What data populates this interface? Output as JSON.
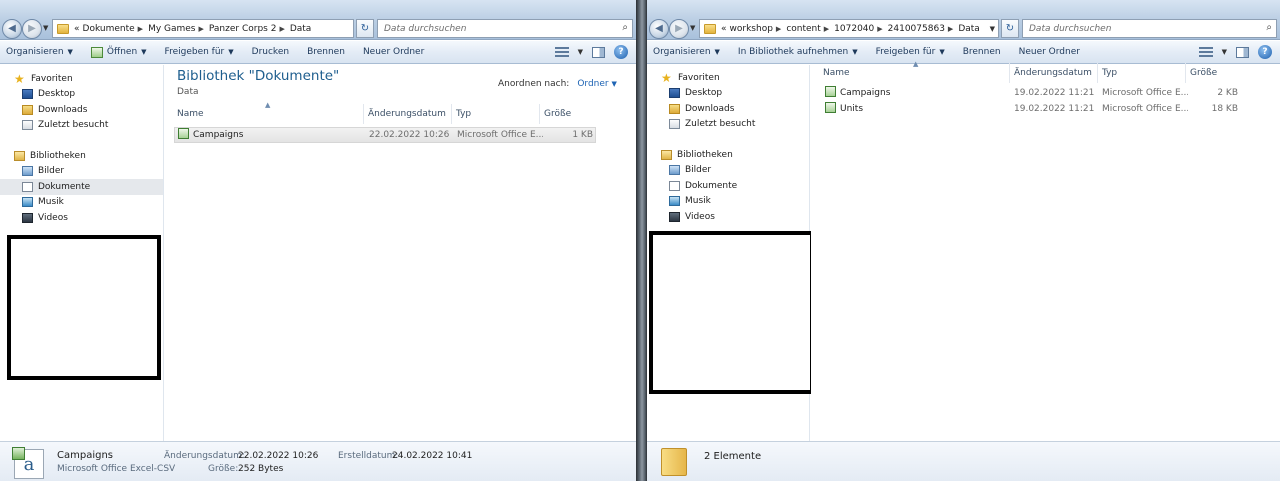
{
  "left": {
    "breadcrumb": [
      "«",
      "Dokumente",
      "My Games",
      "Panzer Corps 2",
      "Data"
    ],
    "search_placeholder": "Data durchsuchen",
    "toolbar": [
      "Organisieren",
      "Öffnen",
      "Freigeben für",
      "Drucken",
      "Brennen",
      "Neuer Ordner"
    ],
    "nav": {
      "favorites": "Favoriten",
      "fav_items": [
        "Desktop",
        "Downloads",
        "Zuletzt besucht"
      ],
      "libraries": "Bibliotheken",
      "lib_items": [
        "Bilder",
        "Dokumente",
        "Musik",
        "Videos"
      ]
    },
    "library_title": "Bibliothek \"Dokumente\"",
    "library_subtitle": "Data",
    "arrange_label": "Anordnen nach:",
    "arrange_value": "Ordner",
    "columns": [
      "Name",
      "Änderungsdatum",
      "Typ",
      "Größe"
    ],
    "files": [
      {
        "name": "Campaigns",
        "date": "22.02.2022 10:26",
        "type": "Microsoft Office E...",
        "size": "1 KB"
      }
    ],
    "status": {
      "name": "Campaigns",
      "type": "Microsoft Office Excel-CSV",
      "modified_label": "Änderungsdatum:",
      "modified": "22.02.2022 10:26",
      "created_label": "Erstelldatum:",
      "created": "24.02.2022 10:41",
      "size_label": "Größe:",
      "size": "252 Bytes"
    }
  },
  "right": {
    "breadcrumb": [
      "«",
      "workshop",
      "content",
      "1072040",
      "2410075863",
      "Data"
    ],
    "search_placeholder": "Data durchsuchen",
    "toolbar": [
      "Organisieren",
      "In Bibliothek aufnehmen",
      "Freigeben für",
      "Brennen",
      "Neuer Ordner"
    ],
    "nav": {
      "favorites": "Favoriten",
      "fav_items": [
        "Desktop",
        "Downloads",
        "Zuletzt besucht"
      ],
      "libraries": "Bibliotheken",
      "lib_items": [
        "Bilder",
        "Dokumente",
        "Musik",
        "Videos"
      ]
    },
    "columns": [
      "Name",
      "Änderungsdatum",
      "Typ",
      "Größe"
    ],
    "files": [
      {
        "name": "Campaigns",
        "date": "19.02.2022 11:21",
        "type": "Microsoft Office E...",
        "size": "2 KB"
      },
      {
        "name": "Units",
        "date": "19.02.2022 11:21",
        "type": "Microsoft Office E...",
        "size": "18 KB"
      }
    ],
    "status": {
      "count": "2 Elemente"
    }
  },
  "icons": {
    "back": "back-arrow-icon",
    "forward": "forward-arrow-icon",
    "refresh": "refresh-icon",
    "search": "search-icon",
    "help": "help-icon",
    "file": "excel-csv-file-icon",
    "folder": "folder-icon"
  },
  "colors": {
    "title_blue": "#1e5e8e",
    "link_blue": "#1e64b4",
    "toolbar_text": "#1e395b"
  }
}
